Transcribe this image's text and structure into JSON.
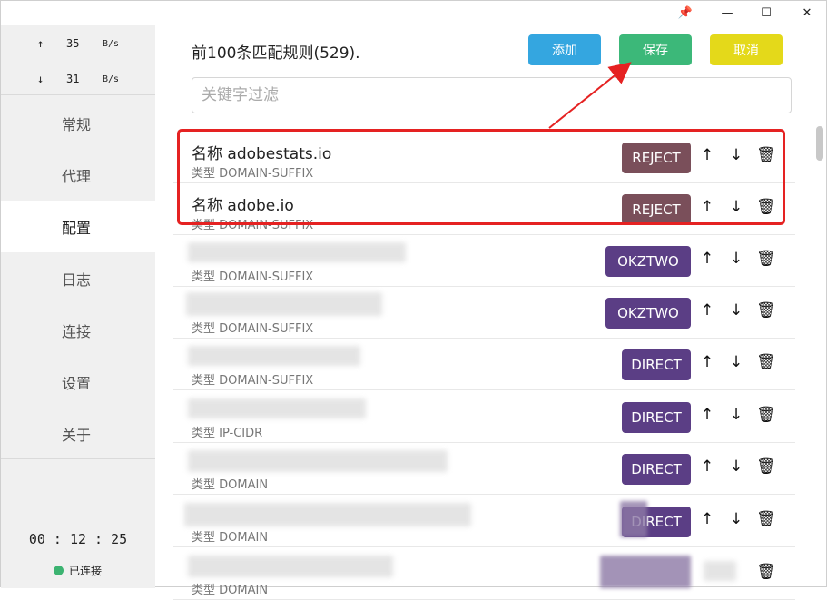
{
  "titlebar": {
    "pin": "📌",
    "minimize": "—",
    "maximize": "☐",
    "close": "✕"
  },
  "sidebar": {
    "upload": {
      "arrow": "↑",
      "value": "35",
      "unit": "B/s"
    },
    "download": {
      "arrow": "↓",
      "value": "31",
      "unit": "B/s"
    },
    "nav": [
      {
        "label": "常规"
      },
      {
        "label": "代理"
      },
      {
        "label": "配置"
      },
      {
        "label": "日志"
      },
      {
        "label": "连接"
      },
      {
        "label": "设置"
      },
      {
        "label": "关于"
      }
    ],
    "active_index": 2,
    "timer": "00 : 12 : 25",
    "status": "已连接"
  },
  "header": {
    "title": "前100条匹配规则(529).",
    "add_label": "添加",
    "save_label": "保存",
    "cancel_label": "取消"
  },
  "filter": {
    "placeholder": "关键字过滤",
    "value": ""
  },
  "rules": [
    {
      "name": "名称 adobestats.io",
      "type": "类型 DOMAIN-SUFFIX",
      "policy": "REJECT"
    },
    {
      "name": "名称 adobe.io",
      "type": "类型 DOMAIN-SUFFIX",
      "policy": "REJECT"
    },
    {
      "name": "",
      "type": "类型 DOMAIN-SUFFIX",
      "policy": "OKZTWO"
    },
    {
      "name": "",
      "type": "类型 DOMAIN-SUFFIX",
      "policy": "OKZTWO"
    },
    {
      "name": "",
      "type": "类型 DOMAIN-SUFFIX",
      "policy": "DIRECT"
    },
    {
      "name": "",
      "type": "类型 IP-CIDR",
      "policy": "DIRECT"
    },
    {
      "name": "",
      "type": "类型 DOMAIN",
      "policy": "DIRECT"
    },
    {
      "name": "",
      "type": "类型 DOMAIN",
      "policy": "DIRECT"
    },
    {
      "name": "",
      "type": "类型 DOMAIN",
      "policy": ""
    }
  ],
  "actions": {
    "up": "↑",
    "down": "↓",
    "delete": "🗑"
  },
  "colors": {
    "add": "#34a6e0",
    "save": "#3cb879",
    "cancel": "#e4d91a",
    "reject": "#7a4f5a",
    "okztwo": "#5b3e85",
    "direct": "#5b3e85",
    "annotation": "#e52222",
    "connected": "#3cb371"
  }
}
